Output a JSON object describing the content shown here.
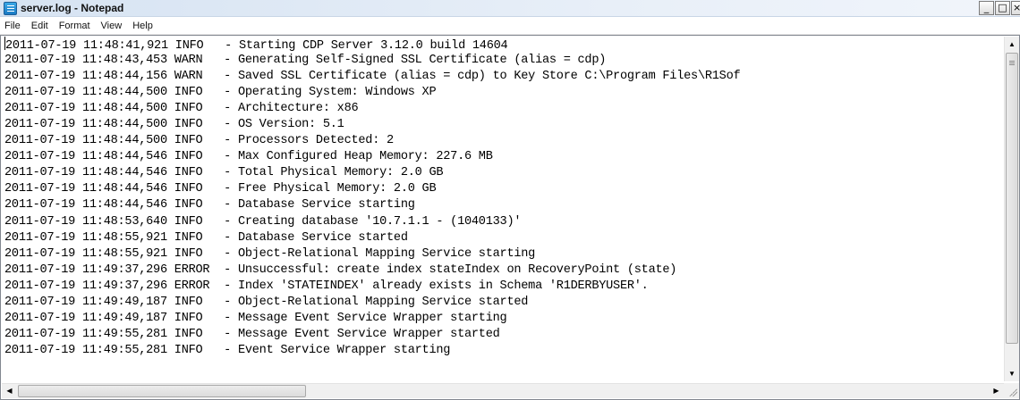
{
  "window": {
    "title": "server.log - Notepad",
    "icon": "notepad-icon",
    "controls": {
      "minimize": "_",
      "maximize": "□",
      "close": "×"
    }
  },
  "menu": [
    "File",
    "Edit",
    "Format",
    "View",
    "Help"
  ],
  "log_lines": [
    "2011-07-19 11:48:41,921 INFO   - Starting CDP Server 3.12.0 build 14604",
    "2011-07-19 11:48:43,453 WARN   - Generating Self-Signed SSL Certificate (alias = cdp)",
    "2011-07-19 11:48:44,156 WARN   - Saved SSL Certificate (alias = cdp) to Key Store C:\\Program Files\\R1Sof",
    "2011-07-19 11:48:44,500 INFO   - Operating System: Windows XP",
    "2011-07-19 11:48:44,500 INFO   - Architecture: x86",
    "2011-07-19 11:48:44,500 INFO   - OS Version: 5.1",
    "2011-07-19 11:48:44,500 INFO   - Processors Detected: 2",
    "2011-07-19 11:48:44,546 INFO   - Max Configured Heap Memory: 227.6 MB",
    "2011-07-19 11:48:44,546 INFO   - Total Physical Memory: 2.0 GB",
    "2011-07-19 11:48:44,546 INFO   - Free Physical Memory: 2.0 GB",
    "2011-07-19 11:48:44,546 INFO   - Database Service starting",
    "2011-07-19 11:48:53,640 INFO   - Creating database '10.7.1.1 - (1040133)'",
    "2011-07-19 11:48:55,921 INFO   - Database Service started",
    "2011-07-19 11:48:55,921 INFO   - Object-Relational Mapping Service starting",
    "2011-07-19 11:49:37,296 ERROR  - Unsuccessful: create index stateIndex on RecoveryPoint (state)",
    "2011-07-19 11:49:37,296 ERROR  - Index 'STATEINDEX' already exists in Schema 'R1DERBYUSER'.",
    "2011-07-19 11:49:49,187 INFO   - Object-Relational Mapping Service started",
    "2011-07-19 11:49:49,187 INFO   - Message Event Service Wrapper starting",
    "2011-07-19 11:49:55,281 INFO   - Message Event Service Wrapper started",
    "2011-07-19 11:49:55,281 INFO   - Event Service Wrapper starting"
  ],
  "scrollbars": {
    "vertical": {
      "up": "▲",
      "down": "▼"
    },
    "horizontal": {
      "left": "◀",
      "right": "▶"
    }
  }
}
